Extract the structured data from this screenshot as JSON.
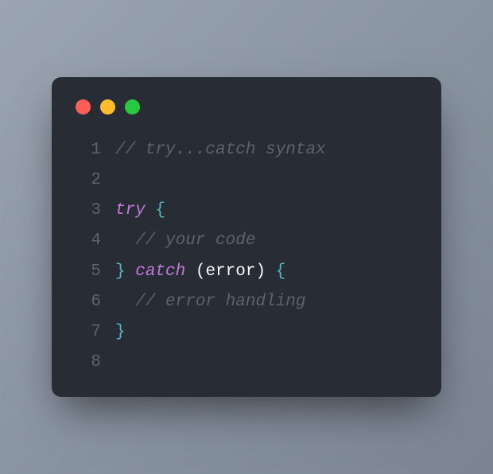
{
  "window": {
    "dots": [
      "red",
      "yellow",
      "green"
    ]
  },
  "colors": {
    "red": "#ff5f56",
    "yellow": "#ffbd2e",
    "green": "#27c93f",
    "background": "#282c34",
    "comment": "#5c6370",
    "keyword": "#c678dd",
    "brace": "#56b6c2",
    "identifier": "#f8fafc"
  },
  "lines": [
    {
      "num": "1",
      "tokens": [
        {
          "cls": "tok-comment",
          "t": "// try...catch syntax"
        }
      ]
    },
    {
      "num": "2",
      "tokens": [
        {
          "cls": "",
          "t": ""
        }
      ]
    },
    {
      "num": "3",
      "tokens": [
        {
          "cls": "tok-keyword",
          "t": "try"
        },
        {
          "cls": "tok-punct",
          "t": " "
        },
        {
          "cls": "tok-brace",
          "t": "{"
        }
      ]
    },
    {
      "num": "4",
      "tokens": [
        {
          "cls": "",
          "t": "  "
        },
        {
          "cls": "tok-comment",
          "t": "// your code"
        }
      ]
    },
    {
      "num": "5",
      "tokens": [
        {
          "cls": "tok-brace",
          "t": "}"
        },
        {
          "cls": "tok-punct",
          "t": " "
        },
        {
          "cls": "tok-keyword",
          "t": "catch"
        },
        {
          "cls": "tok-punct",
          "t": " "
        },
        {
          "cls": "tok-ident",
          "t": "(error)"
        },
        {
          "cls": "tok-punct",
          "t": " "
        },
        {
          "cls": "tok-brace",
          "t": "{"
        }
      ]
    },
    {
      "num": "6",
      "tokens": [
        {
          "cls": "",
          "t": "  "
        },
        {
          "cls": "tok-comment",
          "t": "// error handling"
        }
      ]
    },
    {
      "num": "7",
      "tokens": [
        {
          "cls": "tok-brace",
          "t": "}"
        }
      ]
    },
    {
      "num": "8",
      "tokens": [
        {
          "cls": "",
          "t": ""
        }
      ]
    }
  ]
}
